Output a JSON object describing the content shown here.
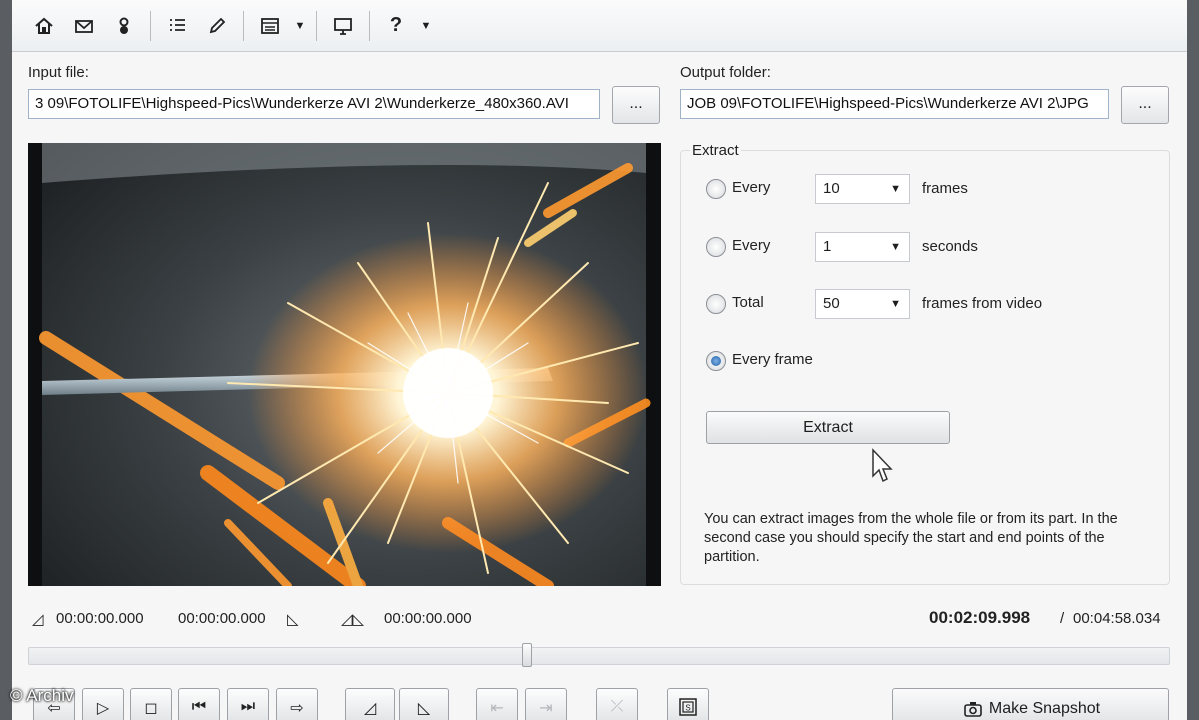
{
  "toolbar": {
    "items": [
      {
        "name": "home-icon"
      },
      {
        "name": "mail-icon"
      },
      {
        "name": "user-icon"
      },
      {
        "name": "list-icon"
      },
      {
        "name": "pencil-icon"
      },
      {
        "name": "window-icon"
      },
      {
        "name": "monitor-icon"
      },
      {
        "name": "help-icon",
        "glyph": "?"
      }
    ]
  },
  "input": {
    "label": "Input file:",
    "value": "3 09\\FOTOLIFE\\Highspeed-Pics\\Wunderkerze AVI 2\\Wunderkerze_480x360.AVI",
    "browse_label": "..."
  },
  "output": {
    "label": "Output folder:",
    "value": "JOB 09\\FOTOLIFE\\Highspeed-Pics\\Wunderkerze AVI 2\\JPG",
    "browse_label": "..."
  },
  "extract": {
    "group_title": "Extract",
    "options": [
      {
        "label": "Every",
        "value": "10",
        "unit": "frames",
        "selected": false
      },
      {
        "label": "Every",
        "value": "1",
        "unit": "seconds",
        "selected": false
      },
      {
        "label": "Total",
        "value": "50",
        "unit": "frames from video",
        "selected": false
      },
      {
        "label": "Every frame",
        "selected": true
      }
    ],
    "button_label": "Extract",
    "help_text": "You can extract images from the whole file or from its part. In the second case you should specify the start and end points of the partition."
  },
  "timeline": {
    "start_time": "00:00:00.000",
    "end_time": "00:00:00.000",
    "selection_time": "00:00:00.000",
    "current_time": "00:02:09.998",
    "separator": "/",
    "total_time": "00:04:58.034",
    "position_fraction": 0.436
  },
  "playback": {
    "snapshot_label": "Make Snapshot"
  },
  "watermark": "© Archiv",
  "colors": {
    "accent": "#1f5fa8",
    "window_border": "#5a5e63",
    "background": "#f6f6f6"
  }
}
